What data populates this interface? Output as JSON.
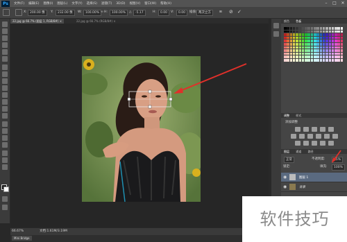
{
  "app": {
    "logo": "Ps"
  },
  "menu": [
    "文件(F)",
    "编辑(E)",
    "图像(I)",
    "图层(L)",
    "文字(Y)",
    "选择(S)",
    "滤镜(T)",
    "3D(D)",
    "视图(V)",
    "窗口(W)",
    "帮助(H)"
  ],
  "window_controls": [
    "–",
    "□",
    "✕"
  ],
  "options": {
    "x_label": "X:",
    "x_value": "200.00 像",
    "y_label": "Y:",
    "y_value": "232.00 像",
    "w_label": "W:",
    "w_value": "100.00%",
    "h_label": "H:",
    "h_value": "100.00%",
    "angle_value": "-5.17",
    "hskew_label": "H:",
    "hskew_value": "0.00",
    "vskew_label": "V:",
    "vskew_value": "0.00",
    "interpolation": "两次立方"
  },
  "tabs": [
    {
      "label": "22.jpg @ 66.7% (图层 1, RGB/8#) ×"
    },
    {
      "label": "22.jpg @ 66.7% (RGB/8#) ×"
    }
  ],
  "status": {
    "zoom": "66.67%",
    "doc": "文档:1.61M/3.19M"
  },
  "bottom_tab": "Mini Bridge",
  "panels": {
    "swatches_tabs": [
      "颜色",
      "色板"
    ],
    "adjustments_tabs": [
      "调整",
      "样式"
    ],
    "adjustments_title": "添加调整",
    "layers_tabs": [
      "图层",
      "通道",
      "路径"
    ],
    "blend_mode": "正常",
    "opacity_label": "不透明度:",
    "opacity_value": "65%",
    "fill_label": "填充:",
    "fill_value": "100%",
    "lock_label": "锁定:",
    "layers": [
      {
        "name": "图层 1"
      },
      {
        "name": "背景"
      }
    ]
  },
  "watermark": "软件技巧",
  "colors": {
    "accent_arrow": "#e0302a",
    "panel": "#454545",
    "canvas": "#262626"
  }
}
